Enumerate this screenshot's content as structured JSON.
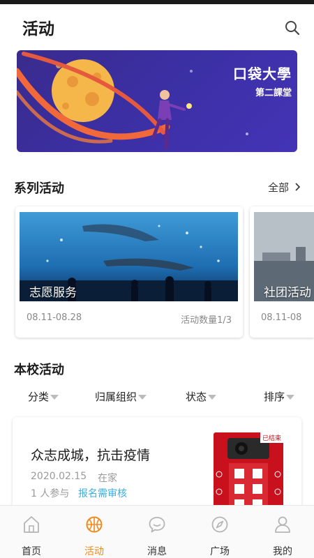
{
  "header": {
    "title": "活动"
  },
  "banner": {
    "title": "口袋大學",
    "subtitle": "第二課堂"
  },
  "series": {
    "title": "系列活动",
    "all_label": "全部",
    "cards": [
      {
        "label": "志愿服务",
        "date": "08.11-08.28",
        "count": "活动数量1/3"
      },
      {
        "label": "社团活动",
        "date": "08.11-08"
      }
    ]
  },
  "school": {
    "title": "本校活动",
    "filters": [
      "分类",
      "归属组织",
      "状态",
      "排序"
    ]
  },
  "activity": {
    "title": "众志成城，抗击疫情",
    "date": "2020.02.15",
    "location": "在家",
    "participants": "1 人参与",
    "audit": "报名需审核",
    "badge": "已结束"
  },
  "tabs": [
    {
      "label": "首页",
      "icon": "home-icon"
    },
    {
      "label": "活动",
      "icon": "basketball-icon",
      "active": true
    },
    {
      "label": "消息",
      "icon": "chat-icon"
    },
    {
      "label": "广场",
      "icon": "compass-icon"
    },
    {
      "label": "我的",
      "icon": "person-icon"
    }
  ],
  "colors": {
    "accent": "#f08a1c",
    "link": "#3aaee0",
    "banner": "#3b2fa3"
  }
}
